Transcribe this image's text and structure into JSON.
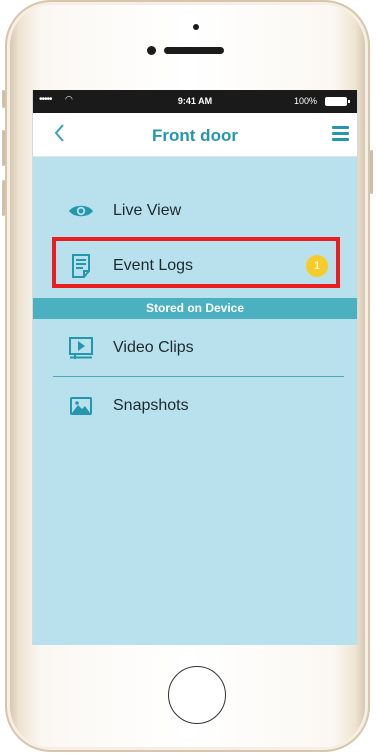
{
  "status_bar": {
    "signal": "•••••",
    "wifi": "◠",
    "time": "9:41 AM",
    "battery": "100%"
  },
  "nav": {
    "title": "Front door",
    "back_icon": "chevron-left-icon",
    "menu_icon": "hamburger-menu-icon"
  },
  "menu_items": [
    {
      "label": "Live View",
      "icon": "eye-icon"
    },
    {
      "label": "Event Logs",
      "icon": "document-icon",
      "badge": "1"
    }
  ],
  "section_header": "Stored on Device",
  "stored_items": [
    {
      "label": "Video Clips",
      "icon": "video-play-icon"
    },
    {
      "label": "Snapshots",
      "icon": "image-icon"
    }
  ],
  "colors": {
    "accent": "#2597ac",
    "screen_bg": "#b9e1ed",
    "section_bg": "#4bb0bf",
    "badge": "#f6cc2a",
    "highlight": "#ea1e1e"
  }
}
